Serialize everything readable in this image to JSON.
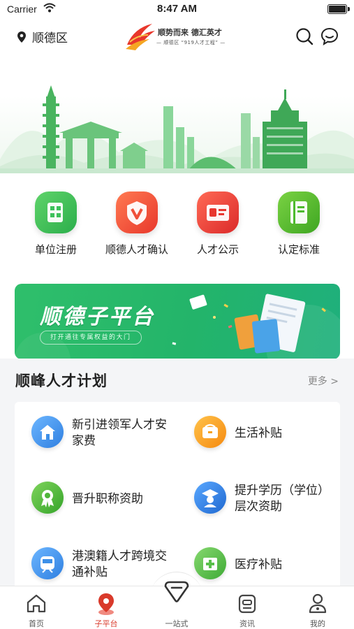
{
  "status_bar": {
    "carrier": "Carrier",
    "time": "8:47 AM"
  },
  "header": {
    "location": "顺德区",
    "logo_slogan": "顺势而来 德汇英才",
    "logo_sub": "— 顺德区 “919人才工程” —"
  },
  "quick_entries": [
    {
      "label": "单位注册",
      "icon": "building-grid-icon",
      "color": "#3cc15a"
    },
    {
      "label": "顺德人才确认",
      "icon": "v-badge-icon",
      "color": "#f0503a"
    },
    {
      "label": "人才公示",
      "icon": "id-card-icon",
      "color": "#e8362f"
    },
    {
      "label": "认定标准",
      "icon": "book-icon",
      "color": "#4dbb2e"
    }
  ],
  "promo": {
    "title": "顺德子平台",
    "subtitle": "打开通往专属权益的大门"
  },
  "section": {
    "title": "顺峰人才计划",
    "more": "更多 >",
    "items": [
      {
        "label": "新引进领军人才安家费",
        "icon": "house-icon",
        "color": "#3c8fe8"
      },
      {
        "label": "生活补贴",
        "icon": "wallet-icon",
        "color": "#f7a21b"
      },
      {
        "label": "晋升职称资助",
        "icon": "award-ribbon-icon",
        "color": "#4fb53a"
      },
      {
        "label": "提升学历（学位）层次资助",
        "icon": "graduate-icon",
        "color": "#2f7fe0"
      },
      {
        "label": "港澳籍人才跨境交通补贴",
        "icon": "train-icon",
        "color": "#3c8fe8"
      },
      {
        "label": "医疗补贴",
        "icon": "medical-icon",
        "color": "#58c04a"
      }
    ]
  },
  "tabbar": {
    "tabs": [
      {
        "label": "首页",
        "icon": "home-icon",
        "active": false
      },
      {
        "label": "子平台",
        "icon": "location-pin-icon",
        "active": true
      },
      {
        "label": "一站式",
        "icon": "one-stop-icon",
        "active": false
      },
      {
        "label": "资讯",
        "icon": "news-icon",
        "active": false
      },
      {
        "label": "我的",
        "icon": "user-icon",
        "active": false
      }
    ]
  }
}
